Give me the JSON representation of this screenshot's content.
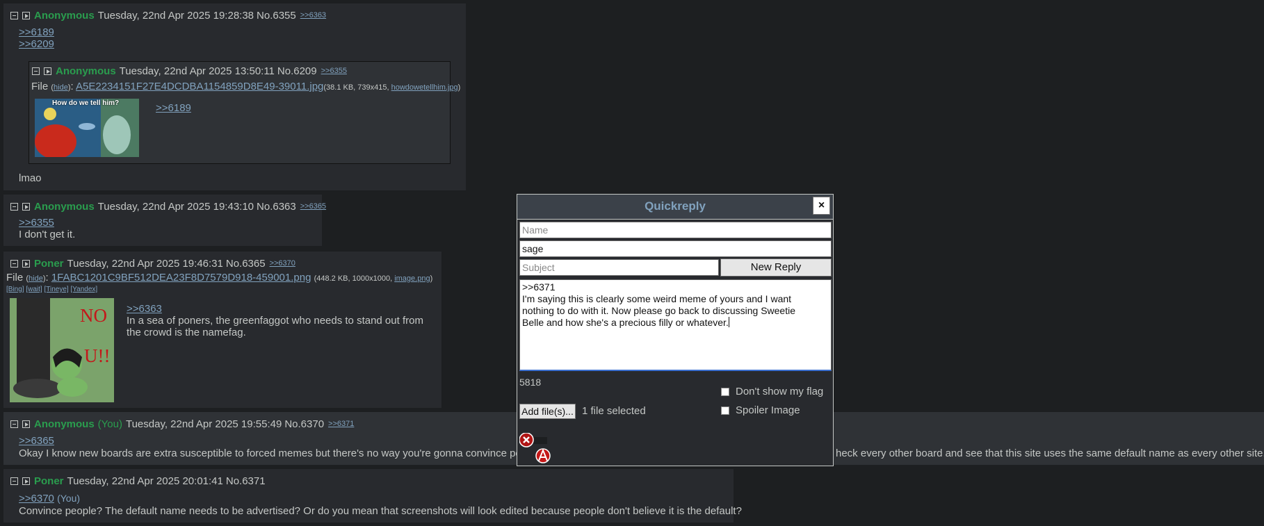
{
  "posts": [
    {
      "id": "6355",
      "name": "Anonymous",
      "date": "Tuesday, 22nd Apr 2025 19:28:38",
      "no": "No.6355",
      "backlinks": [
        ">>6363"
      ],
      "quotes": [
        ">>6189",
        ">>6209"
      ],
      "text": "lmao",
      "inline": {
        "name": "Anonymous",
        "date": "Tuesday, 22nd Apr 2025 13:50:11",
        "no": "No.6209",
        "backlink": ">>6355",
        "file_label": "File",
        "file_hide": "hide",
        "file_name": "A5E2234151F27E4DCDBA1154859D8E49-39011.jpg",
        "file_info_pre": "(38.1 KB, 739x415, ",
        "file_orig": "howdowetellhim.jpg",
        "file_info_post": ")",
        "thumb_caption": "How do we tell him?",
        "quote": ">>6189"
      }
    },
    {
      "id": "6363",
      "name": "Anonymous",
      "date": "Tuesday, 22nd Apr 2025 19:43:10",
      "no": "No.6363",
      "backlinks": [
        ">>6365"
      ],
      "quote": ">>6355",
      "text": "I don't get it."
    },
    {
      "id": "6365",
      "name": "Poner",
      "date": "Tuesday, 22nd Apr 2025 19:46:31",
      "no": "No.6365",
      "backlinks": [
        ">>6370"
      ],
      "file_label": "File",
      "file_hide": "hide",
      "file_name": "1FABC1201C9BF512DEA23F8D7579D918-459001.png",
      "file_info_pre": "(448.2 KB, 1000x1000, ",
      "file_orig": "image.png",
      "file_info_post": ")",
      "search_links": [
        "[Bing]",
        "[wait]",
        "[Tineye]",
        "[Yandex]"
      ],
      "thumb_text": [
        "NO",
        "U!!"
      ],
      "quote": ">>6363",
      "text_lines": [
        "In a sea of poners, the greenfaggot who needs to stand out from",
        "the crowd is the namefag."
      ]
    },
    {
      "id": "6370",
      "name": "Anonymous",
      "you": "(You)",
      "date": "Tuesday, 22nd Apr 2025 19:55:49",
      "no": "No.6370",
      "backlinks": [
        ">>6371"
      ],
      "quote": ">>6365",
      "text_left": "Okay I know new boards are extra susceptible to forced memes but there's no way you're gonna convince peop",
      "text_right": "heck every other board and see that this site uses the same default name as every other site."
    },
    {
      "id": "6371",
      "name": "Poner",
      "date": "Tuesday, 22nd Apr 2025 20:01:41",
      "no": "No.6371",
      "quote": ">>6370",
      "quote_you": "(You)",
      "text": "Convince people? The default name needs to be advertised? Or do you mean that screenshots will look edited because people don't believe it is the default?"
    }
  ],
  "quickreply": {
    "title": "Quickreply",
    "close": "×",
    "name_placeholder": "Name",
    "email_value": "sage",
    "subject_placeholder": "Subject",
    "submit_label": "New Reply",
    "message": ">>6371\nI'm saying this is clearly some weird meme of yours and I want\nnothing to do with it. Now please go back to discussing Sweetie\nBelle and how she's a precious filly or whatever.",
    "char_count": "5818",
    "no_flag_label": "Don't show my flag",
    "spoiler_label": "Spoiler Image",
    "add_file_label": "Add file(s)...",
    "files_selected": "1 file selected",
    "remove_icon": "x-circle-icon",
    "flag_icon": "anarchy-icon"
  },
  "colors": {
    "name": "#2a9d4e",
    "link": "#81a2be",
    "post_bg": "#282a2e",
    "page_bg": "#1d1f21"
  }
}
